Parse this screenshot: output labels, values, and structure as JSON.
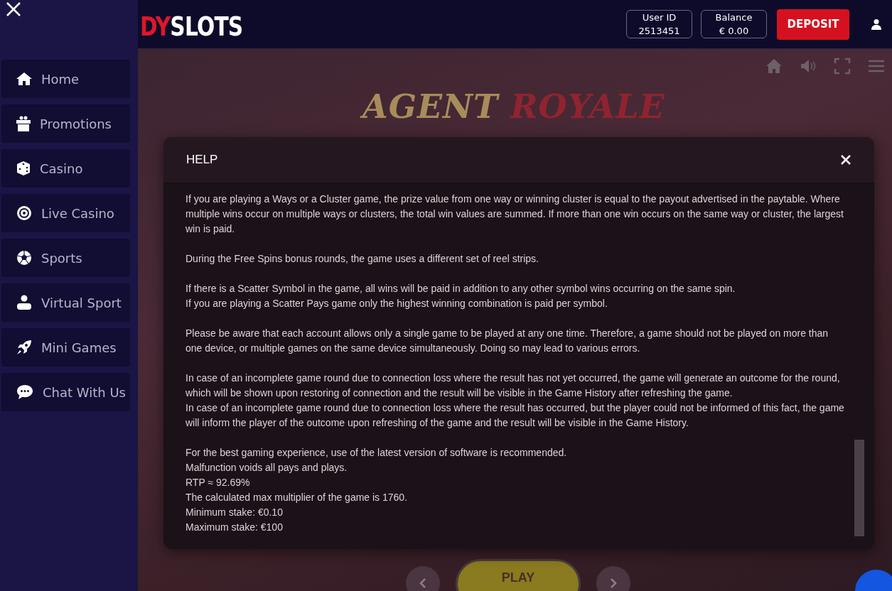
{
  "header": {
    "logo": {
      "accent": "DY",
      "main": "SLOTS"
    },
    "user_id": {
      "label": "User ID",
      "value": "2513451"
    },
    "balance": {
      "label": "Balance",
      "value": "€ 0.00"
    },
    "deposit_button": "DEPOSIT"
  },
  "sidebar": {
    "items": [
      {
        "kind": "home",
        "label": "Home"
      },
      {
        "kind": "gift",
        "label": "Promotions"
      },
      {
        "kind": "dice",
        "label": "Casino"
      },
      {
        "kind": "roulette",
        "label": "Live Casino"
      },
      {
        "kind": "ball",
        "label": "Sports"
      },
      {
        "kind": "virtual",
        "label": "Virtual Sport"
      },
      {
        "kind": "rocket",
        "label": "Mini Games"
      },
      {
        "kind": "chat",
        "label": "Chat With Us"
      }
    ]
  },
  "game": {
    "title_parts": [
      "AGENT",
      "ROYALE"
    ],
    "play_button": "PLAY"
  },
  "help": {
    "title": "HELP",
    "paragraphs": [
      [
        "If you are playing a Ways or a Cluster game, the prize value from one way or winning cluster is equal to the payout advertised in the paytable. Where multiple wins occur on multiple ways or clusters, the total win values are summed. If more than one win occurs on the same way or cluster, the largest win is paid."
      ],
      [
        "During the Free Spins bonus rounds, the game uses a different set of reel strips."
      ],
      [
        "If there is a Scatter Symbol in the game, all wins will be paid in addition to any other symbol wins occurring on the same spin.",
        "If you are playing a Scatter Pays game only the highest winning combination is paid per symbol."
      ],
      [
        "Please be aware that each account allows only a single game to be played at any one time. Therefore, a game should not be played on more than one device, or multiple games on the same device simultaneously. Doing so may lead to various errors."
      ],
      [
        "In case of an incomplete game round due to connection loss where the result has not yet occurred, the game will generate an outcome for the round, which will be shown upon restoring of connection and the result will be visible in the Game History after refreshing the game.",
        "In case of an incomplete game round due to connection loss where the result has occurred, but the player could not be informed of this fact, the game will inform the player of the outcome upon refreshing of the game and the result will be visible in the Game History."
      ],
      [
        "For the best gaming experience, use of the latest version of software is recommended.",
        "Malfunction voids all pays and plays.",
        "RTP ≈ 92.69%",
        "The calculated max multiplier of the game is 1760.",
        "Minimum stake: €0.10",
        "Maximum stake: €100"
      ]
    ]
  }
}
